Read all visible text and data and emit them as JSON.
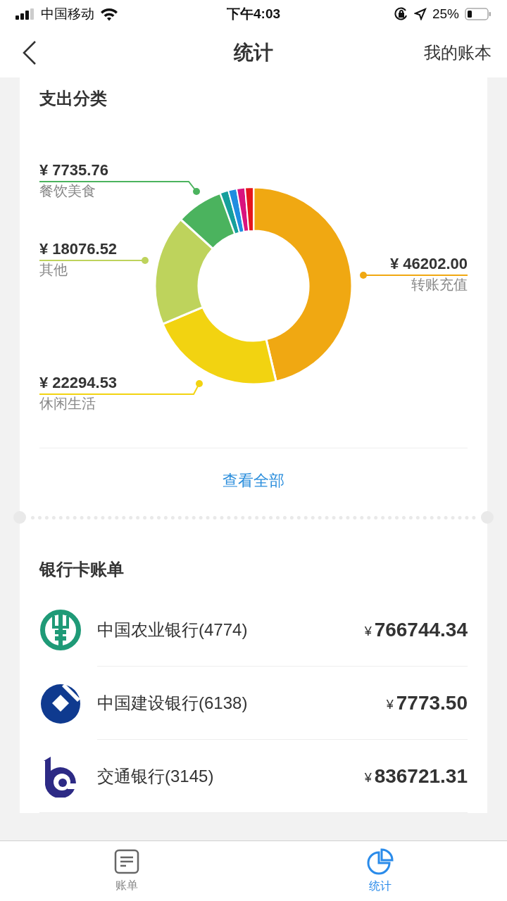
{
  "status_bar": {
    "carrier": "中国移动",
    "time": "下午4:03",
    "battery": "25%"
  },
  "nav": {
    "title": "统计",
    "action": "我的账本"
  },
  "expense": {
    "title": "支出分类",
    "slices": [
      {
        "amount": "¥ 7735.76",
        "name": "餐饮美食",
        "color": "#4bb35e"
      },
      {
        "amount": "¥ 18076.52",
        "name": "其他",
        "color": "#bed35c"
      },
      {
        "amount": "¥ 46202.00",
        "name": "转账充值",
        "color": "#f0a812"
      },
      {
        "amount": "¥ 22294.53",
        "name": "休闲生活",
        "color": "#f2d311"
      }
    ],
    "minor_slices": [
      {
        "color": "#159f9c"
      },
      {
        "color": "#1f8de0"
      },
      {
        "color": "#d9137e"
      },
      {
        "color": "#e5161e"
      }
    ],
    "more": "查看全部"
  },
  "banks": {
    "title": "银行卡账单",
    "rows": [
      {
        "kind": "abc",
        "name": "中国农业银行(4774)",
        "currency": "¥",
        "amount": "766744.34"
      },
      {
        "kind": "ccb",
        "name": "中国建设银行(6138)",
        "currency": "¥",
        "amount": "7773.50"
      },
      {
        "kind": "bocom",
        "name": "交通银行(3145)",
        "currency": "¥",
        "amount": "836721.31"
      }
    ]
  },
  "tabs": [
    {
      "label": "账单",
      "kind": "bill",
      "selected": false
    },
    {
      "label": "统计",
      "kind": "stats",
      "selected": true
    }
  ]
}
